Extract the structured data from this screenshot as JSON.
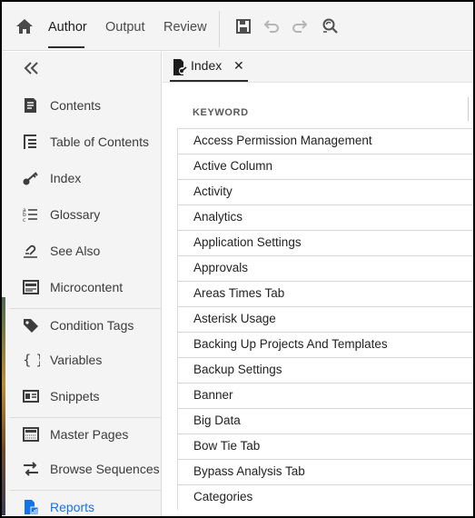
{
  "toolbar": {
    "tabs": [
      {
        "label": "Author",
        "active": true
      },
      {
        "label": "Output",
        "active": false
      },
      {
        "label": "Review",
        "active": false
      }
    ],
    "icons": [
      "home-icon",
      "save-icon",
      "undo-icon",
      "redo-icon",
      "find-replace-icon"
    ]
  },
  "sidebar": {
    "collapse_icon": "double-chevron-left-icon",
    "items": [
      {
        "label": "Contents",
        "icon": "contents-icon"
      },
      {
        "label": "Table of Contents",
        "icon": "table-of-contents-icon"
      },
      {
        "label": "Index",
        "icon": "key-icon"
      },
      {
        "label": "Glossary",
        "icon": "glossary-icon"
      },
      {
        "label": "See Also",
        "icon": "see-also-icon"
      },
      {
        "label": "Microcontent",
        "icon": "microcontent-icon"
      },
      {
        "label": "Condition Tags",
        "icon": "tag-icon"
      },
      {
        "label": "Variables",
        "icon": "braces-icon"
      },
      {
        "label": "Snippets",
        "icon": "snippets-icon"
      },
      {
        "label": "Master Pages",
        "icon": "master-pages-icon"
      },
      {
        "label": "Browse Sequences",
        "icon": "browse-sequences-icon"
      },
      {
        "label": "Reports",
        "icon": "reports-icon",
        "active": true
      }
    ]
  },
  "document_tab": {
    "label": "Index",
    "close": "✕",
    "icon": "index-document-icon"
  },
  "table": {
    "column_header": "KEYWORD",
    "rows": [
      "Access Permission Management",
      "Active Column",
      "Activity",
      "Analytics",
      "Application Settings",
      "Approvals",
      "Areas Times Tab",
      "Asterisk Usage",
      "Backing Up Projects And Templates",
      "Backup Settings",
      "Banner",
      "Big Data",
      "Bow Tie Tab",
      "Bypass Analysis Tab",
      "Categories"
    ]
  },
  "colors": {
    "accent": "#1473e6",
    "panel": "#f4f4f4",
    "text": "#2c2c2c"
  }
}
